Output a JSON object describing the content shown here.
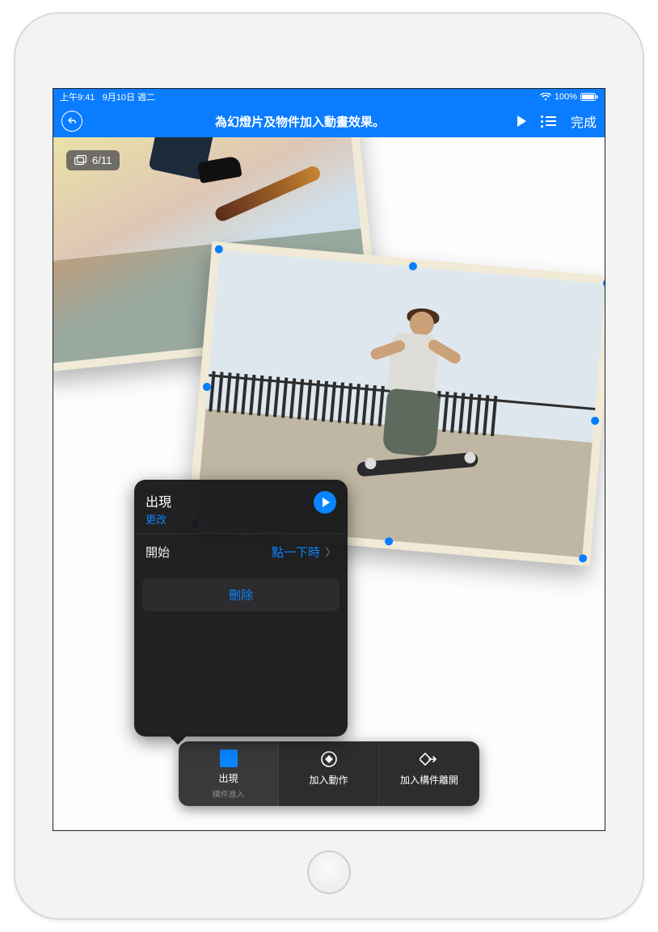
{
  "status": {
    "time": "上午9:41",
    "date": "9月10日 週二",
    "battery": "100%"
  },
  "navbar": {
    "title": "為幻燈片及物件加入動畫效果。",
    "done": "完成"
  },
  "slide_counter": "6/11",
  "popover": {
    "effect_name": "出現",
    "change": "更改",
    "start_label": "開始",
    "start_value": "點一下時",
    "delete": "刪除"
  },
  "buildbar": {
    "tab1_label": "出現",
    "tab1_sub": "構件進入",
    "tab2_label": "加入動作",
    "tab3_label": "加入構件離開"
  }
}
